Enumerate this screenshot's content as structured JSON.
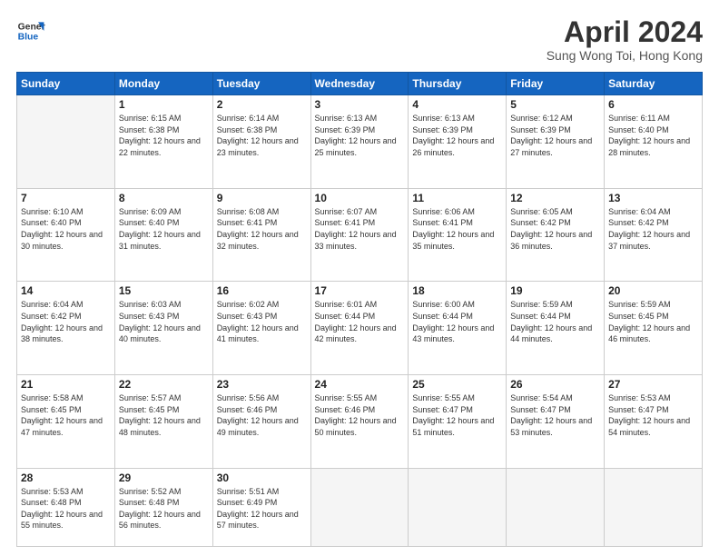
{
  "header": {
    "logo_line1": "General",
    "logo_line2": "Blue",
    "month": "April 2024",
    "location": "Sung Wong Toi, Hong Kong"
  },
  "days_of_week": [
    "Sunday",
    "Monday",
    "Tuesday",
    "Wednesday",
    "Thursday",
    "Friday",
    "Saturday"
  ],
  "weeks": [
    [
      {
        "day": "",
        "info": ""
      },
      {
        "day": "1",
        "info": "Sunrise: 6:15 AM\nSunset: 6:38 PM\nDaylight: 12 hours\nand 22 minutes."
      },
      {
        "day": "2",
        "info": "Sunrise: 6:14 AM\nSunset: 6:38 PM\nDaylight: 12 hours\nand 23 minutes."
      },
      {
        "day": "3",
        "info": "Sunrise: 6:13 AM\nSunset: 6:39 PM\nDaylight: 12 hours\nand 25 minutes."
      },
      {
        "day": "4",
        "info": "Sunrise: 6:13 AM\nSunset: 6:39 PM\nDaylight: 12 hours\nand 26 minutes."
      },
      {
        "day": "5",
        "info": "Sunrise: 6:12 AM\nSunset: 6:39 PM\nDaylight: 12 hours\nand 27 minutes."
      },
      {
        "day": "6",
        "info": "Sunrise: 6:11 AM\nSunset: 6:40 PM\nDaylight: 12 hours\nand 28 minutes."
      }
    ],
    [
      {
        "day": "7",
        "info": "Sunrise: 6:10 AM\nSunset: 6:40 PM\nDaylight: 12 hours\nand 30 minutes."
      },
      {
        "day": "8",
        "info": "Sunrise: 6:09 AM\nSunset: 6:40 PM\nDaylight: 12 hours\nand 31 minutes."
      },
      {
        "day": "9",
        "info": "Sunrise: 6:08 AM\nSunset: 6:41 PM\nDaylight: 12 hours\nand 32 minutes."
      },
      {
        "day": "10",
        "info": "Sunrise: 6:07 AM\nSunset: 6:41 PM\nDaylight: 12 hours\nand 33 minutes."
      },
      {
        "day": "11",
        "info": "Sunrise: 6:06 AM\nSunset: 6:41 PM\nDaylight: 12 hours\nand 35 minutes."
      },
      {
        "day": "12",
        "info": "Sunrise: 6:05 AM\nSunset: 6:42 PM\nDaylight: 12 hours\nand 36 minutes."
      },
      {
        "day": "13",
        "info": "Sunrise: 6:04 AM\nSunset: 6:42 PM\nDaylight: 12 hours\nand 37 minutes."
      }
    ],
    [
      {
        "day": "14",
        "info": "Sunrise: 6:04 AM\nSunset: 6:42 PM\nDaylight: 12 hours\nand 38 minutes."
      },
      {
        "day": "15",
        "info": "Sunrise: 6:03 AM\nSunset: 6:43 PM\nDaylight: 12 hours\nand 40 minutes."
      },
      {
        "day": "16",
        "info": "Sunrise: 6:02 AM\nSunset: 6:43 PM\nDaylight: 12 hours\nand 41 minutes."
      },
      {
        "day": "17",
        "info": "Sunrise: 6:01 AM\nSunset: 6:44 PM\nDaylight: 12 hours\nand 42 minutes."
      },
      {
        "day": "18",
        "info": "Sunrise: 6:00 AM\nSunset: 6:44 PM\nDaylight: 12 hours\nand 43 minutes."
      },
      {
        "day": "19",
        "info": "Sunrise: 5:59 AM\nSunset: 6:44 PM\nDaylight: 12 hours\nand 44 minutes."
      },
      {
        "day": "20",
        "info": "Sunrise: 5:59 AM\nSunset: 6:45 PM\nDaylight: 12 hours\nand 46 minutes."
      }
    ],
    [
      {
        "day": "21",
        "info": "Sunrise: 5:58 AM\nSunset: 6:45 PM\nDaylight: 12 hours\nand 47 minutes."
      },
      {
        "day": "22",
        "info": "Sunrise: 5:57 AM\nSunset: 6:45 PM\nDaylight: 12 hours\nand 48 minutes."
      },
      {
        "day": "23",
        "info": "Sunrise: 5:56 AM\nSunset: 6:46 PM\nDaylight: 12 hours\nand 49 minutes."
      },
      {
        "day": "24",
        "info": "Sunrise: 5:55 AM\nSunset: 6:46 PM\nDaylight: 12 hours\nand 50 minutes."
      },
      {
        "day": "25",
        "info": "Sunrise: 5:55 AM\nSunset: 6:47 PM\nDaylight: 12 hours\nand 51 minutes."
      },
      {
        "day": "26",
        "info": "Sunrise: 5:54 AM\nSunset: 6:47 PM\nDaylight: 12 hours\nand 53 minutes."
      },
      {
        "day": "27",
        "info": "Sunrise: 5:53 AM\nSunset: 6:47 PM\nDaylight: 12 hours\nand 54 minutes."
      }
    ],
    [
      {
        "day": "28",
        "info": "Sunrise: 5:53 AM\nSunset: 6:48 PM\nDaylight: 12 hours\nand 55 minutes."
      },
      {
        "day": "29",
        "info": "Sunrise: 5:52 AM\nSunset: 6:48 PM\nDaylight: 12 hours\nand 56 minutes."
      },
      {
        "day": "30",
        "info": "Sunrise: 5:51 AM\nSunset: 6:49 PM\nDaylight: 12 hours\nand 57 minutes."
      },
      {
        "day": "",
        "info": ""
      },
      {
        "day": "",
        "info": ""
      },
      {
        "day": "",
        "info": ""
      },
      {
        "day": "",
        "info": ""
      }
    ]
  ]
}
